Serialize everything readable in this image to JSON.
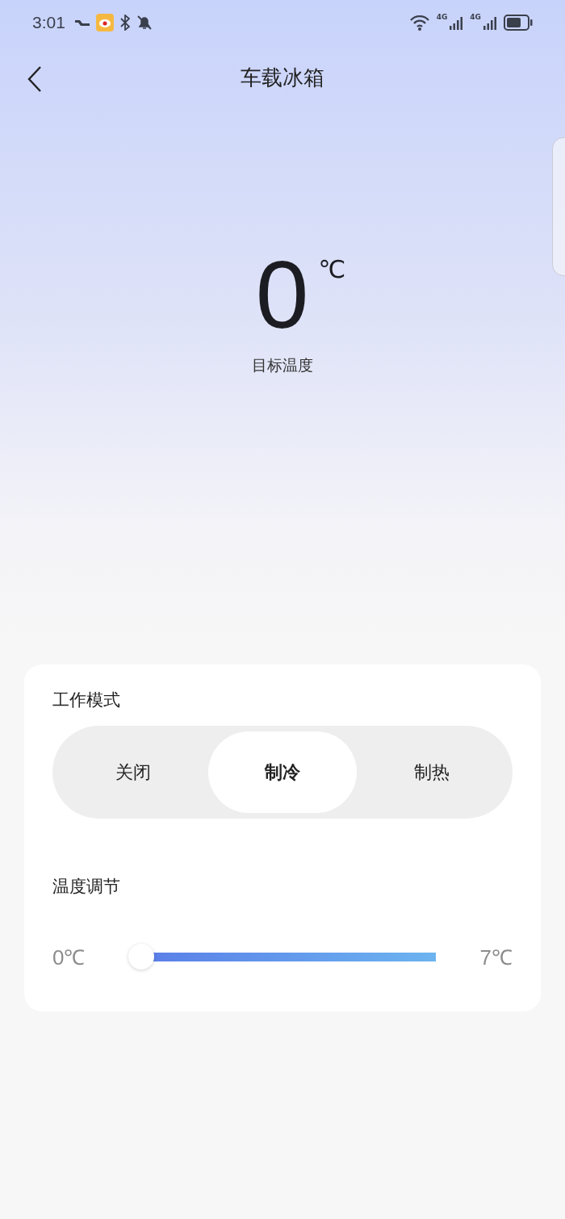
{
  "status_bar": {
    "time": "3:01",
    "network_labels": [
      "4G",
      "4G"
    ]
  },
  "header": {
    "title": "车载冰箱"
  },
  "temperature": {
    "value": "0",
    "unit": "℃",
    "caption": "目标温度"
  },
  "mode": {
    "label": "工作模式",
    "options": [
      {
        "label": "关闭",
        "selected": false
      },
      {
        "label": "制冷",
        "selected": true
      },
      {
        "label": "制热",
        "selected": false
      }
    ]
  },
  "adjust": {
    "label": "温度调节",
    "min_label": "0℃",
    "max_label": "7℃",
    "level": 0
  }
}
